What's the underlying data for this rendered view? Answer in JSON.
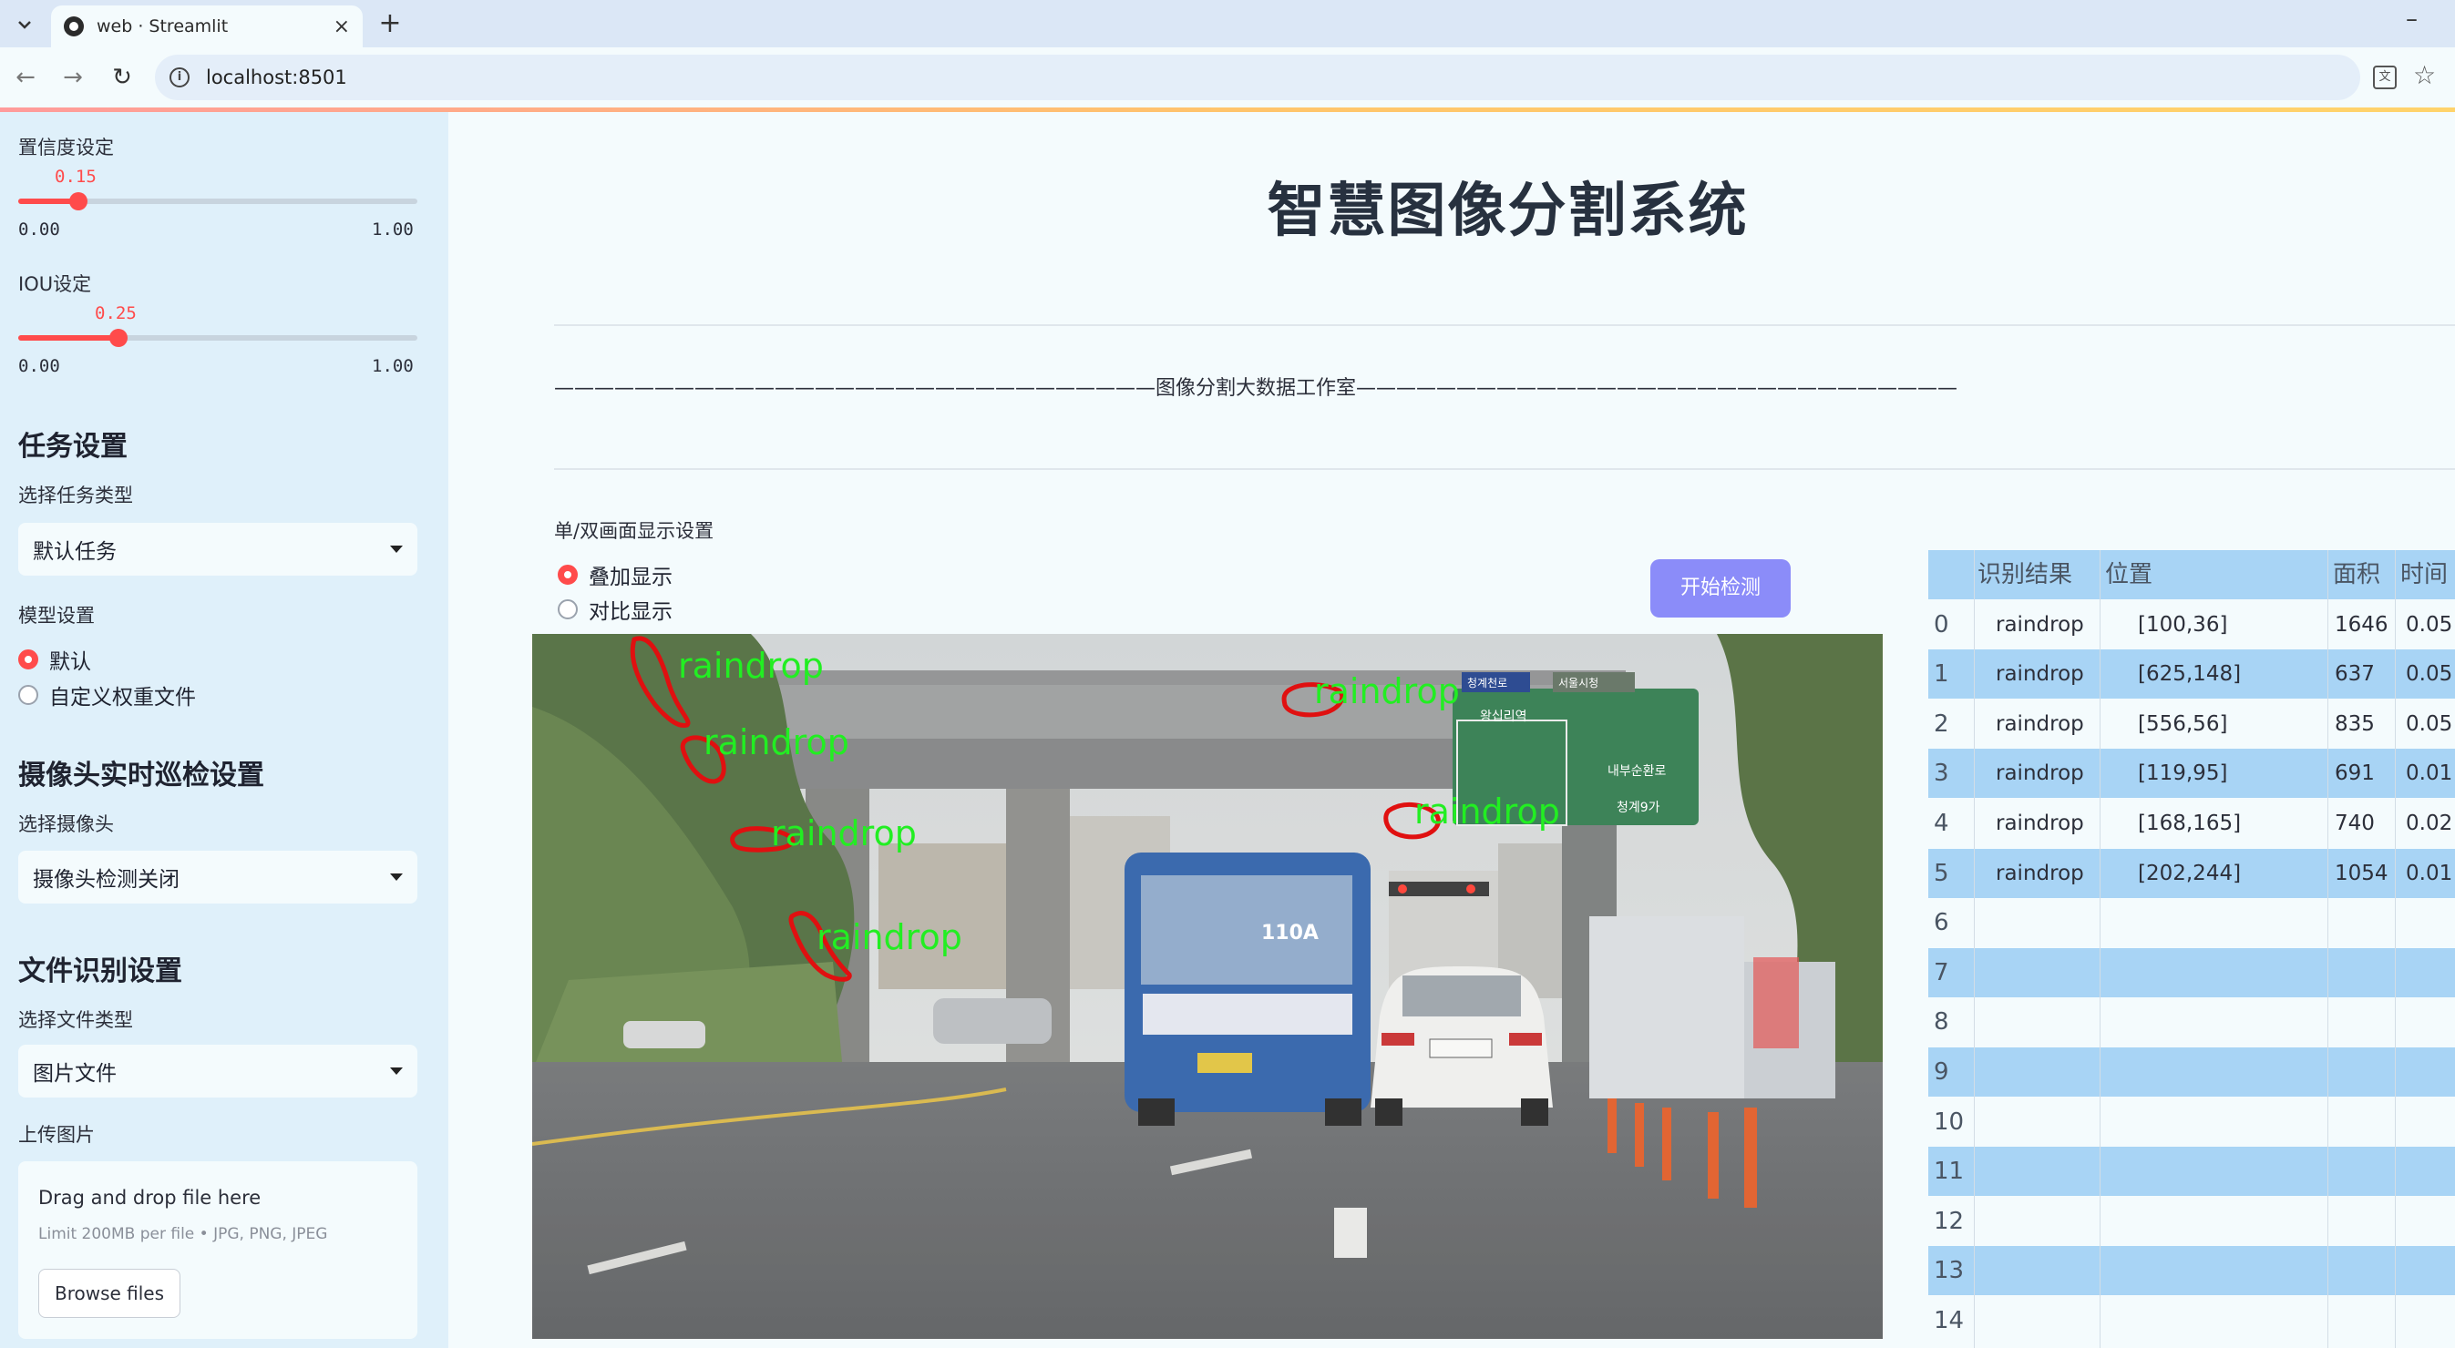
{
  "browser": {
    "tab_title": "web · Streamlit",
    "url": "localhost:8501",
    "new_tab": "+",
    "close": "×",
    "minimize": "–"
  },
  "sidebar": {
    "confidence": {
      "label": "置信度设定",
      "value": "0.15",
      "min": "0.00",
      "max": "1.00",
      "fraction": 0.15
    },
    "iou": {
      "label": "IOU设定",
      "value": "0.25",
      "min": "0.00",
      "max": "1.00",
      "fraction": 0.25
    },
    "task_heading": "任务设置",
    "task_type_label": "选择任务类型",
    "task_type_value": "默认任务",
    "model_label": "模型设置",
    "model_options": [
      "默认",
      "自定义权重文件"
    ],
    "model_selected": "默认",
    "camera_heading": "摄像头实时巡检设置",
    "camera_label": "选择摄像头",
    "camera_value": "摄像头检测关闭",
    "file_heading": "文件识别设置",
    "file_type_label": "选择文件类型",
    "file_type_value": "图片文件",
    "upload_label": "上传图片",
    "uploader_title": "Drag and drop file here",
    "uploader_limit": "Limit 200MB per file • JPG, PNG, JPEG",
    "browse_label": "Browse files"
  },
  "main": {
    "title": "智慧图像分割系统",
    "studio_line": "——————————————————————————————图像分割大数据工作室——————————————————————————————",
    "display_label": "单/双画面显示设置",
    "display_options": [
      "叠加显示",
      "对比显示"
    ],
    "display_selected": "叠加显示",
    "detect_button": "开始检测"
  },
  "scene": {
    "detection_label": "raindrop",
    "labels": [
      "raindrop",
      "raindrop",
      "raindrop",
      "raindrop",
      "raindrop",
      "raindrop"
    ],
    "bus_number": "110A",
    "sign_text_1": "청계천로",
    "sign_text_2": "서울시청",
    "sign_text_3": "왕십리역",
    "sign_text_4": "내부순환로",
    "sign_text_5": "청계9가",
    "outline_color": "#e01010",
    "label_color": "#22ee22"
  },
  "table": {
    "headers": [
      "",
      "识别结果",
      "位置",
      "面积",
      "时间"
    ],
    "rows": [
      [
        "0",
        "raindrop",
        "[100,36]",
        "1646",
        "0.05"
      ],
      [
        "1",
        "raindrop",
        "[625,148]",
        "637",
        "0.05"
      ],
      [
        "2",
        "raindrop",
        "[556,56]",
        "835",
        "0.05"
      ],
      [
        "3",
        "raindrop",
        "[119,95]",
        "691",
        "0.01"
      ],
      [
        "4",
        "raindrop",
        "[168,165]",
        "740",
        "0.02"
      ],
      [
        "5",
        "raindrop",
        "[202,244]",
        "1054",
        "0.01"
      ],
      [
        "6",
        "",
        "",
        "",
        ""
      ],
      [
        "7",
        "",
        "",
        "",
        ""
      ],
      [
        "8",
        "",
        "",
        "",
        ""
      ],
      [
        "9",
        "",
        "",
        "",
        ""
      ],
      [
        "10",
        "",
        "",
        "",
        ""
      ],
      [
        "11",
        "",
        "",
        "",
        ""
      ],
      [
        "12",
        "",
        "",
        "",
        ""
      ],
      [
        "13",
        "",
        "",
        "",
        ""
      ],
      [
        "14",
        "",
        "",
        "",
        ""
      ]
    ],
    "header_bg": "#a8d4f5",
    "stripe_bg": "#a8d4f5",
    "plain_bg": "#f4fbfd"
  }
}
